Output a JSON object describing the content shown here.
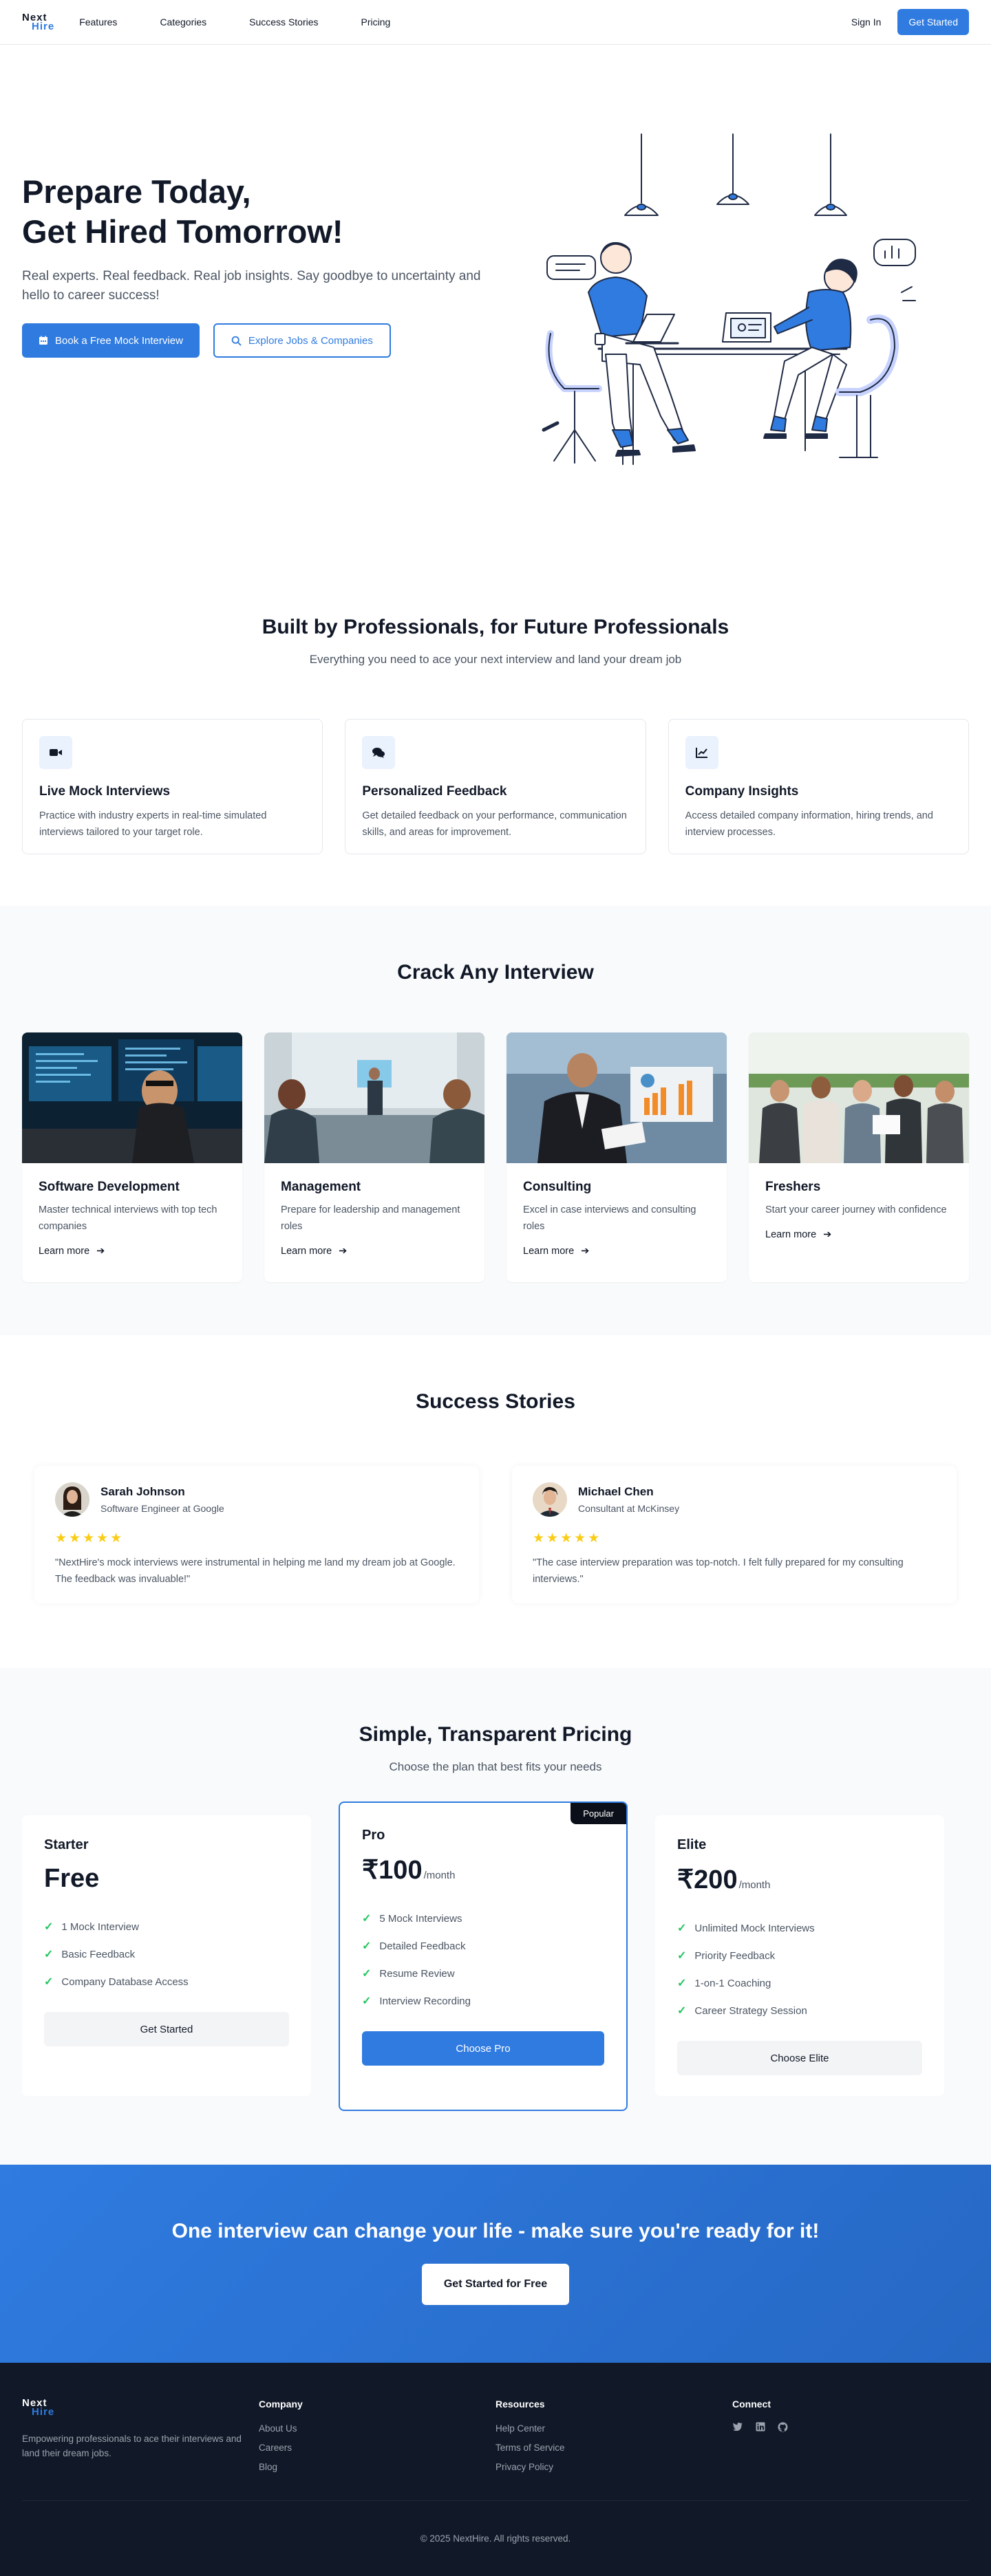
{
  "brand": {
    "line1": "Next",
    "line2": "Hire",
    "accent": "#2f7be0"
  },
  "nav": {
    "links": [
      "Features",
      "Categories",
      "Success Stories",
      "Pricing"
    ],
    "sign_in": "Sign In",
    "get_started": "Get Started"
  },
  "hero": {
    "title_line1": "Prepare Today,",
    "title_line2": "Get Hired Tomorrow!",
    "subtitle": "Real experts. Real feedback. Real job insights. Say goodbye to uncertainty and hello to career success!",
    "primary_btn": "Book a Free Mock Interview",
    "secondary_btn": "Explore Jobs & Companies"
  },
  "features": {
    "title": "Built by Professionals, for Future Professionals",
    "subtitle": "Everything you need to ace your next interview and land your dream job",
    "items": [
      {
        "icon": "video-icon",
        "title": "Live Mock Interviews",
        "desc": "Practice with industry experts in real-time simulated interviews tailored to your target role."
      },
      {
        "icon": "chat-icon",
        "title": "Personalized Feedback",
        "desc": "Get detailed feedback on your performance, communication skills, and areas for improvement."
      },
      {
        "icon": "chart-icon",
        "title": "Company Insights",
        "desc": "Access detailed company information, hiring trends, and interview processes."
      }
    ]
  },
  "categories": {
    "title": "Crack Any Interview",
    "learn_more": "Learn more",
    "items": [
      {
        "title": "Software Development",
        "desc": "Master technical interviews with top tech companies"
      },
      {
        "title": "Management",
        "desc": "Prepare for leadership and management roles"
      },
      {
        "title": "Consulting",
        "desc": "Excel in case interviews and consulting roles"
      },
      {
        "title": "Freshers",
        "desc": "Start your career journey with confidence"
      }
    ]
  },
  "stories": {
    "title": "Success Stories",
    "items": [
      {
        "name": "Sarah Johnson",
        "role": "Software Engineer at Google",
        "stars": "★★★★★",
        "rating": 5,
        "quote": "\"NextHire's mock interviews were instrumental in helping me land my dream job at Google. The feedback was invaluable!\""
      },
      {
        "name": "Michael Chen",
        "role": "Consultant at McKinsey",
        "stars": "★★★★★",
        "rating": 5,
        "quote": "\"The case interview preparation was top-notch. I felt fully prepared for my consulting interviews.\""
      }
    ]
  },
  "pricing": {
    "title": "Simple, Transparent Pricing",
    "subtitle": "Choose the plan that best fits your needs",
    "popular_badge": "Popular",
    "per": "/month",
    "plans": [
      {
        "name": "Starter",
        "price": "Free",
        "features": [
          "1 Mock Interview",
          "Basic Feedback",
          "Company Database Access"
        ],
        "button": "Get Started"
      },
      {
        "name": "Pro",
        "price": "₹100",
        "features": [
          "5 Mock Interviews",
          "Detailed Feedback",
          "Resume Review",
          "Interview Recording"
        ],
        "button": "Choose Pro"
      },
      {
        "name": "Elite",
        "price": "₹200",
        "features": [
          "Unlimited Mock Interviews",
          "Priority Feedback",
          "1-on-1 Coaching",
          "Career Strategy Session"
        ],
        "button": "Choose Elite"
      }
    ]
  },
  "cta": {
    "title": "One interview can change your life - make sure you're ready for it!",
    "button": "Get Started for Free"
  },
  "footer": {
    "tagline": "Empowering professionals to ace their interviews and land their dream jobs.",
    "company_head": "Company",
    "company_links": [
      "About Us",
      "Careers",
      "Blog"
    ],
    "resources_head": "Resources",
    "resources_links": [
      "Help Center",
      "Terms of Service",
      "Privacy Policy"
    ],
    "connect_head": "Connect",
    "copyright": "© 2025 NextHire. All rights reserved."
  }
}
